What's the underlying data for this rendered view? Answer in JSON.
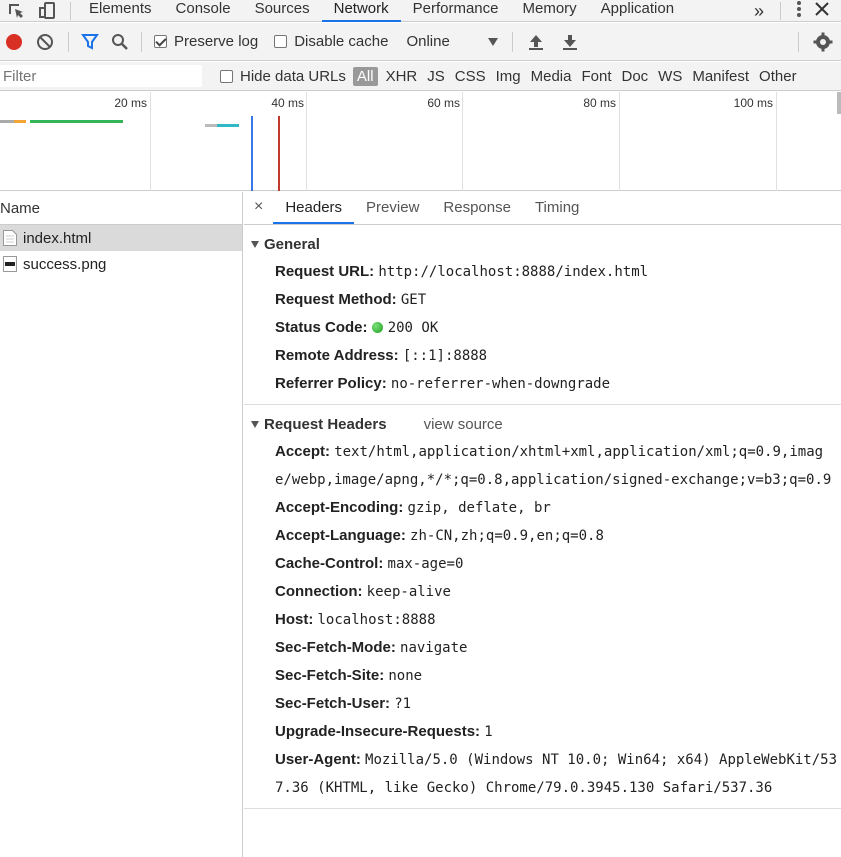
{
  "tabs": {
    "items": [
      "Elements",
      "Console",
      "Sources",
      "Network",
      "Performance",
      "Memory",
      "Application"
    ],
    "active": "Network",
    "more": "»"
  },
  "toolbar": {
    "preserve_log": "Preserve log",
    "disable_cache": "Disable cache",
    "throttling": "Online"
  },
  "filterbar": {
    "placeholder": "Filter",
    "hide_data_urls": "Hide data URLs",
    "types": [
      "All",
      "XHR",
      "JS",
      "CSS",
      "Img",
      "Media",
      "Font",
      "Doc",
      "WS",
      "Manifest",
      "Other"
    ],
    "active_type": "All"
  },
  "overview": {
    "ticks": [
      "20 ms",
      "40 ms",
      "60 ms",
      "80 ms",
      "100 ms"
    ]
  },
  "requests": {
    "header": "Name",
    "items": [
      {
        "name": "index.html",
        "selected": true
      },
      {
        "name": "success.png",
        "selected": false
      }
    ]
  },
  "details": {
    "close": "×",
    "tabs": [
      "Headers",
      "Preview",
      "Response",
      "Timing"
    ],
    "active_tab": "Headers",
    "general": {
      "title": "General",
      "rows": [
        {
          "key": "Request URL:",
          "value": "http://localhost:8888/index.html"
        },
        {
          "key": "Request Method:",
          "value": "GET"
        },
        {
          "key": "Status Code:",
          "value": "200 OK"
        },
        {
          "key": "Remote Address:",
          "value": "[::1]:8888"
        },
        {
          "key": "Referrer Policy:",
          "value": "no-referrer-when-downgrade"
        }
      ]
    },
    "request_headers": {
      "title": "Request Headers",
      "view_source": "view source",
      "rows": [
        {
          "key": "Accept:",
          "value": "text/html,application/xhtml+xml,application/xml;q=0.9,image/webp,image/apng,*/*;q=0.8,application/signed-exchange;v=b3;q=0.9"
        },
        {
          "key": "Accept-Encoding:",
          "value": "gzip, deflate, br"
        },
        {
          "key": "Accept-Language:",
          "value": "zh-CN,zh;q=0.9,en;q=0.8"
        },
        {
          "key": "Cache-Control:",
          "value": "max-age=0"
        },
        {
          "key": "Connection:",
          "value": "keep-alive"
        },
        {
          "key": "Host:",
          "value": "localhost:8888"
        },
        {
          "key": "Sec-Fetch-Mode:",
          "value": "navigate"
        },
        {
          "key": "Sec-Fetch-Site:",
          "value": "none"
        },
        {
          "key": "Sec-Fetch-User:",
          "value": "?1"
        },
        {
          "key": "Upgrade-Insecure-Requests:",
          "value": "1"
        },
        {
          "key": "User-Agent:",
          "value": "Mozilla/5.0 (Windows NT 10.0; Win64; x64) AppleWebKit/537.36 (KHTML, like Gecko) Chrome/79.0.3945.130 Safari/537.36"
        }
      ]
    }
  },
  "colors": {
    "accent": "#1a73e8",
    "record": "#d93025",
    "status_ok": "#1a9e1a"
  }
}
